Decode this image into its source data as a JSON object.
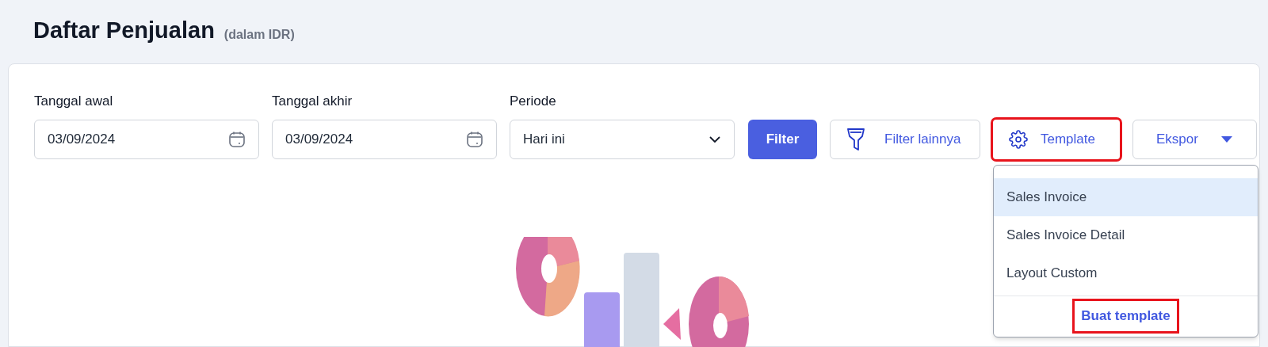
{
  "header": {
    "title": "Daftar Penjualan",
    "subtitle": "(dalam IDR)"
  },
  "filters": [
    {
      "label": "Tanggal awal",
      "kind": "date",
      "value": "03/09/2024"
    },
    {
      "label": "Tanggal akhir",
      "kind": "date",
      "value": "03/09/2024"
    },
    {
      "label": "Periode",
      "kind": "select",
      "value": "Hari ini"
    }
  ],
  "buttons": [
    {
      "label": "Filter",
      "kind": "primary",
      "highlighted": false
    },
    {
      "label": "Filter lainnya",
      "kind": "funnel",
      "highlighted": false
    },
    {
      "label": "Template",
      "kind": "gear",
      "highlighted": true
    },
    {
      "label": "Ekspor",
      "kind": "menu",
      "highlighted": false
    }
  ],
  "template_menu": {
    "items": [
      {
        "label": "Sales Invoice",
        "selected": true
      },
      {
        "label": "Sales Invoice Detail",
        "selected": false
      },
      {
        "label": "Layout Custom",
        "selected": false
      }
    ],
    "footer": {
      "label": "Buat template",
      "highlighted": true
    }
  }
}
